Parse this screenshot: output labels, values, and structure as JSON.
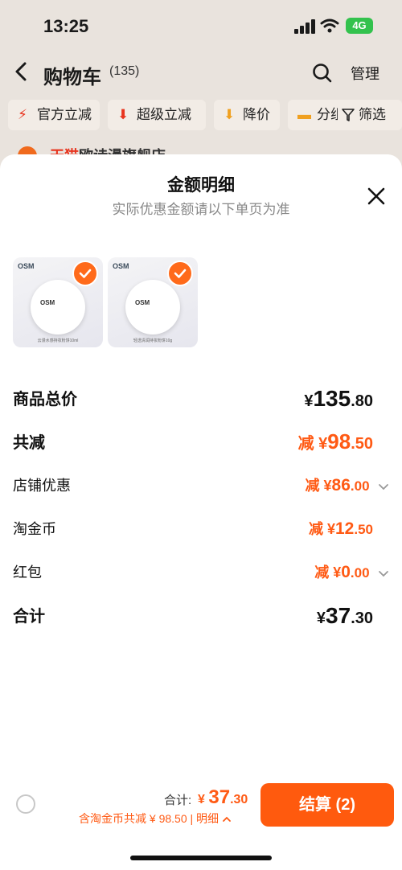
{
  "status": {
    "time": "13:25",
    "network": "4G"
  },
  "header": {
    "title": "购物车",
    "count": "(135)",
    "manage": "管理"
  },
  "filters": {
    "chips": [
      "官方立减",
      "超级立减",
      "降价",
      "分组"
    ],
    "filter_label": "筛选"
  },
  "list_peek": {
    "shop_prefix": "天猫",
    "shop_text": "欧诗漫旗舰店"
  },
  "sheet": {
    "title": "金额明细",
    "subtitle": "实际优惠金额请以下单页为准",
    "products": [
      {
        "brand": "OSM",
        "label": "OSM",
        "caption": "云漫水感持妆粉饼10ml"
      },
      {
        "brand": "OSM",
        "label": "OSM",
        "caption": "轻透清润持妆粉饼10g"
      }
    ],
    "rows": {
      "subtotal": {
        "label": "商品总价",
        "currency": "¥",
        "int": "135",
        "dec": ".80"
      },
      "total_discount": {
        "label": "共减",
        "prefix": "减 ",
        "currency": "¥",
        "int": "98",
        "dec": ".50"
      },
      "store_discount": {
        "label": "店铺优惠",
        "prefix": "减 ",
        "currency": "¥",
        "int": "86",
        "dec": ".00"
      },
      "taobao_coins": {
        "label": "淘金币",
        "prefix": "减 ",
        "currency": "¥",
        "int": "12",
        "dec": ".50"
      },
      "red_packet": {
        "label": "红包",
        "prefix": "减 ",
        "currency": "¥",
        "int": "0",
        "dec": ".00"
      },
      "total": {
        "label": "合计",
        "currency": "¥",
        "int": "37",
        "dec": ".30"
      }
    }
  },
  "bottom": {
    "sum_label": "合计:",
    "currency": "¥",
    "sum_int": "37",
    "sum_dec": ".30",
    "note": "含淘金币共减 ¥ 98.50 | 明细",
    "checkout": "结算 (2)"
  },
  "colors": {
    "accent": "#ff5a14",
    "check": "#ff6a1a",
    "checkout": "#ff5a0e"
  }
}
